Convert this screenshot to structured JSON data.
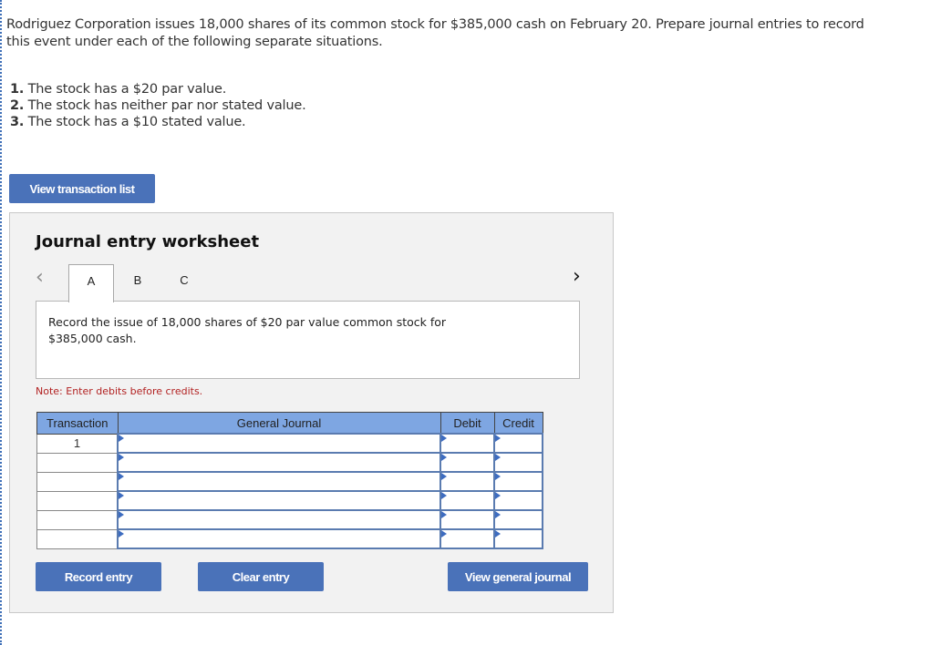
{
  "problem": {
    "text": "Rodriguez Corporation issues 18,000 shares of its common stock for $385,000 cash on February 20. Prepare journal entries to record this event under each of the following separate situations.",
    "requirements": [
      {
        "num": "1.",
        "text": " The stock has a $20 par value."
      },
      {
        "num": "2.",
        "text": " The stock has neither par nor stated value."
      },
      {
        "num": "3.",
        "text": " The stock has a $10 stated value."
      }
    ]
  },
  "buttons": {
    "view_transaction_list": "View transaction list",
    "record_entry": "Record entry",
    "clear_entry": "Clear entry",
    "view_general_journal": "View general journal"
  },
  "worksheet": {
    "title": "Journal entry worksheet",
    "prev_icon": "‹",
    "next_icon": "›",
    "tabs": [
      {
        "label": "A",
        "active": true
      },
      {
        "label": "B",
        "active": false
      },
      {
        "label": "C",
        "active": false
      }
    ],
    "prompt": "Record the issue of 18,000 shares of $20 par value common stock for $385,000 cash.",
    "note": "Note: Enter debits before credits.",
    "table": {
      "headers": [
        "Transaction",
        "General Journal",
        "Debit",
        "Credit"
      ],
      "rows": [
        {
          "transaction": "1",
          "account": "",
          "debit": "",
          "credit": ""
        },
        {
          "transaction": "",
          "account": "",
          "debit": "",
          "credit": ""
        },
        {
          "transaction": "",
          "account": "",
          "debit": "",
          "credit": ""
        },
        {
          "transaction": "",
          "account": "",
          "debit": "",
          "credit": ""
        },
        {
          "transaction": "",
          "account": "",
          "debit": "",
          "credit": ""
        },
        {
          "transaction": "",
          "account": "",
          "debit": "",
          "credit": ""
        }
      ]
    }
  },
  "colors": {
    "accent": "#4a72b9",
    "header_bg": "#7ea6e2",
    "note": "#b22222",
    "panel_bg": "#f2f2f2"
  }
}
